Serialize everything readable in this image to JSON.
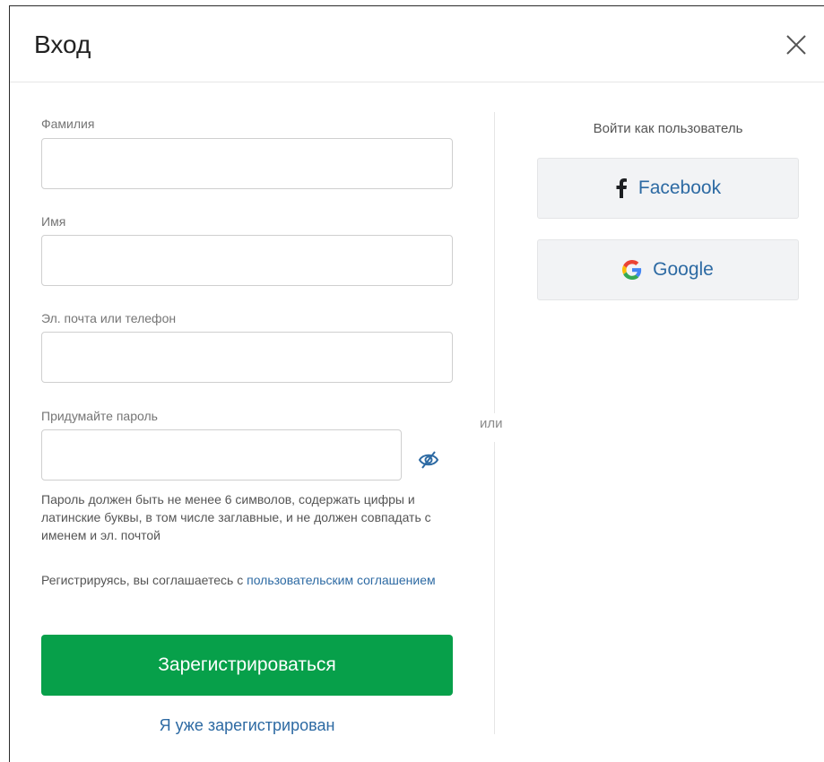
{
  "modal": {
    "title": "Вход"
  },
  "form": {
    "last_name_label": "Фамилия",
    "last_name_value": "",
    "first_name_label": "Имя",
    "first_name_value": "",
    "contact_label": "Эл. почта или телефон",
    "contact_value": "",
    "password_label": "Придумайте пароль",
    "password_value": "",
    "password_hint": "Пароль должен быть не менее 6 символов, содержать цифры и латинские буквы, в том числе заглавные, и не должен совпадать с именем и эл. почтой",
    "terms_prefix": "Регистрируясь, вы соглашаетесь с ",
    "terms_link": "пользовательским соглашением",
    "register_label": "Зарегистрироваться",
    "already_registered_label": "Я уже зарегистрирован"
  },
  "divider": {
    "text": "или"
  },
  "social": {
    "title": "Войти как пользователь",
    "facebook_label": "Facebook",
    "google_label": "Google"
  },
  "icons": {
    "close": "close-icon",
    "password_visibility": "eye-off-icon",
    "facebook": "facebook-icon",
    "google": "google-icon"
  },
  "colors": {
    "primary_green": "#07a04a",
    "link_blue": "#2d6aa3",
    "social_bg": "#f2f3f5",
    "eye_icon": "#2d6aa3"
  }
}
